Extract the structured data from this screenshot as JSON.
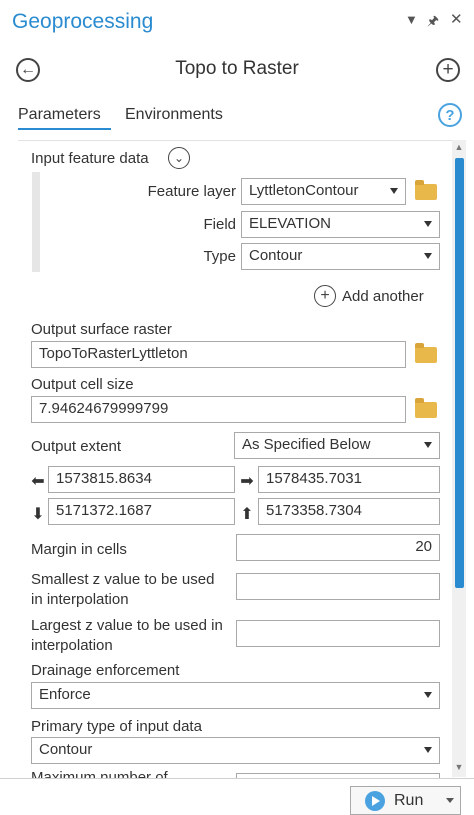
{
  "panel": {
    "title": "Geoprocessing",
    "menu_icon": "dropdown-triangle-icon",
    "pin_icon": "pin-icon",
    "close_icon": "close-icon"
  },
  "tool": {
    "title": "Topo to Raster",
    "back_icon": "back-arrow-icon",
    "add_icon": "plus-circle-icon"
  },
  "tabs": [
    {
      "label": "Parameters",
      "active": true
    },
    {
      "label": "Environments",
      "active": false
    }
  ],
  "help_glyph": "?",
  "params": {
    "input_feature_data": {
      "label": "Input feature data",
      "feature_layer_label": "Feature layer",
      "feature_layer_value": "LyttletonContour",
      "field_label": "Field",
      "field_value": "ELEVATION",
      "type_label": "Type",
      "type_value": "Contour",
      "add_another_label": "Add another"
    },
    "output_surface_raster": {
      "label": "Output surface raster",
      "value": "TopoToRasterLyttleton"
    },
    "output_cell_size": {
      "label": "Output cell size",
      "value": "7.94624679999799"
    },
    "output_extent": {
      "label": "Output extent",
      "value": "As Specified Below",
      "left": "1573815.8634",
      "right": "1578435.7031",
      "bottom": "5171372.1687",
      "top": "5173358.7304"
    },
    "margin_in_cells": {
      "label": "Margin in cells",
      "value": "20"
    },
    "smallest_z": {
      "label_line1": "Smallest z value to be used",
      "label_line2": "in interpolation",
      "value": ""
    },
    "largest_z": {
      "label_line1": "Largest z value to be used in",
      "label_line2": "interpolation",
      "value": ""
    },
    "drainage_enforcement": {
      "label": "Drainage enforcement",
      "value": "Enforce"
    },
    "primary_type": {
      "label": "Primary type of input data",
      "value": "Contour"
    },
    "maximum_iterations": {
      "label": "Maximum number of"
    }
  },
  "footer": {
    "run_label": "Run"
  },
  "colors": {
    "accent": "#2a8bd0",
    "folder": "#e8b84a"
  }
}
